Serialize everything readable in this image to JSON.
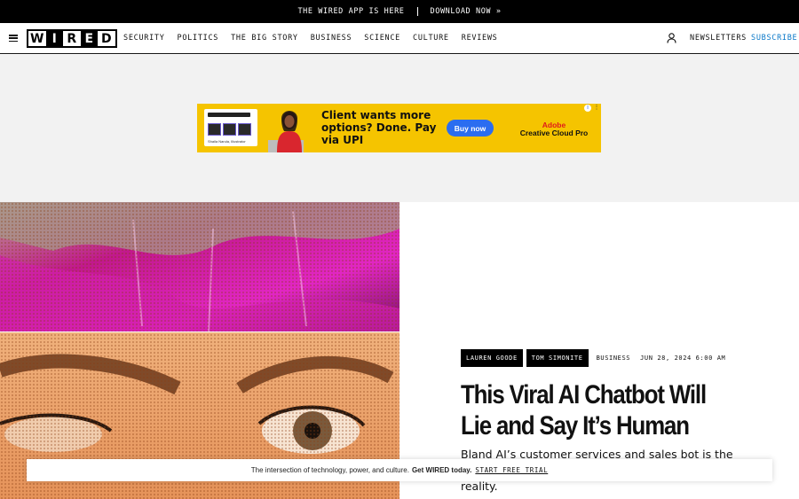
{
  "promo": {
    "message": "THE WIRED APP IS HERE",
    "cta": "DOWNLOAD NOW »"
  },
  "header": {
    "logo_letters": [
      "W",
      "I",
      "R",
      "E",
      "D"
    ],
    "nav": [
      {
        "label": "SECURITY"
      },
      {
        "label": "POLITICS"
      },
      {
        "label": "THE BIG STORY"
      },
      {
        "label": "BUSINESS"
      },
      {
        "label": "SCIENCE"
      },
      {
        "label": "CULTURE"
      },
      {
        "label": "REVIEWS"
      }
    ],
    "newsletters": "NEWSLETTERS",
    "subscribe": "SUBSCRIBE",
    "subscribe_color": "#0a78c8"
  },
  "ad": {
    "headline": "Client wants more options? Done. Pay via UPI",
    "button": "Buy now",
    "brand_line1": "Adobe",
    "brand_line2": "Creative Cloud Pro",
    "mock_caption": "Shaila Narula, Illustrator",
    "background": "#f5c400"
  },
  "article": {
    "authors": [
      "LAUREN GOODE",
      "TOM SIMONITE"
    ],
    "rubric": "BUSINESS",
    "date": "JUN 28, 2024 6:00 AM",
    "headline": "This Viral AI Chatbot Will Lie and Say It’s Human",
    "dek": "Bland AI’s customer services and sales bot is the latest ... against the consequences of blurred reality."
  },
  "banner": {
    "text": "The intersection of technology, power, and culture.",
    "bold": "Get WIRED today.",
    "cta": "START FREE TRIAL"
  }
}
